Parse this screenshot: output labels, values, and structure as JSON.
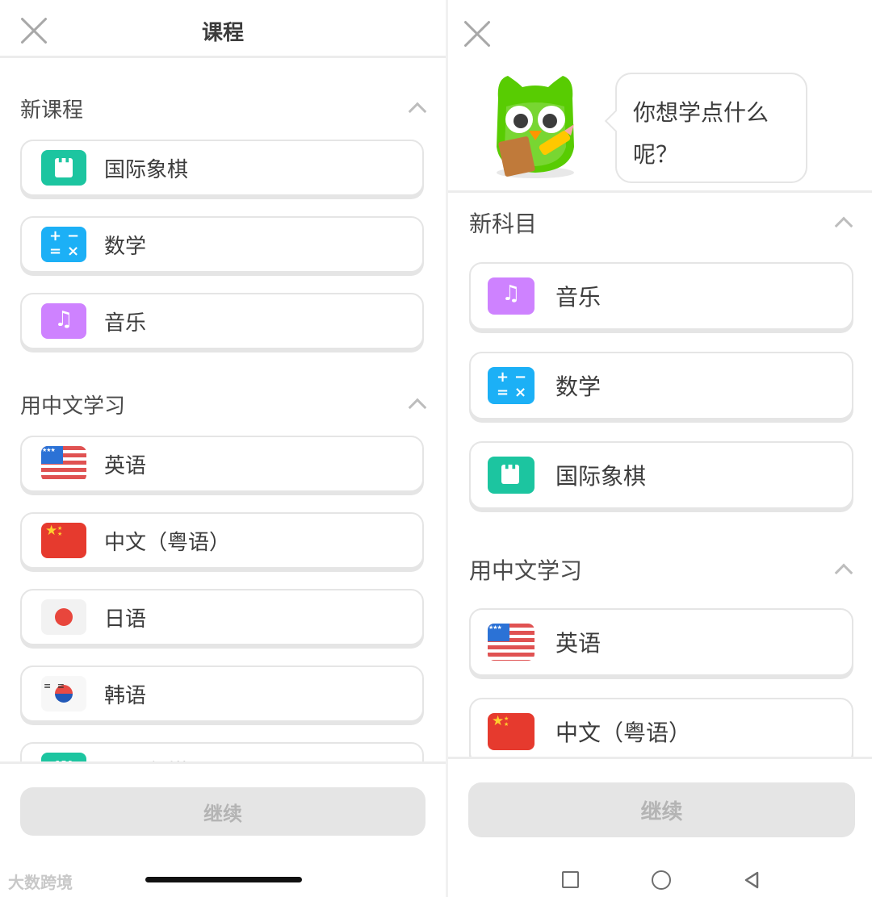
{
  "left": {
    "title": "课程",
    "sections": [
      {
        "title": "新课程",
        "items": [
          {
            "label": "国际象棋",
            "icon": "chess-icon"
          },
          {
            "label": "数学",
            "icon": "math-icon"
          },
          {
            "label": "音乐",
            "icon": "music-icon"
          }
        ]
      },
      {
        "title": "用中文学习",
        "items": [
          {
            "label": "英语",
            "icon": "us-flag-icon"
          },
          {
            "label": "中文（粤语）",
            "icon": "china-flag-icon"
          },
          {
            "label": "日语",
            "icon": "japan-flag-icon"
          },
          {
            "label": "韩语",
            "icon": "korea-flag-icon"
          },
          {
            "label": "国际象棋",
            "icon": "chess-icon"
          }
        ]
      }
    ],
    "continue_label": "继续"
  },
  "right": {
    "bubble_text": "你想学点什么呢？",
    "sections": [
      {
        "title": "新科目",
        "items": [
          {
            "label": "音乐",
            "icon": "music-icon"
          },
          {
            "label": "数学",
            "icon": "math-icon"
          },
          {
            "label": "国际象棋",
            "icon": "chess-icon"
          }
        ]
      },
      {
        "title": "用中文学习",
        "items": [
          {
            "label": "英语",
            "icon": "us-flag-icon"
          },
          {
            "label": "中文（粤语）",
            "icon": "china-flag-icon"
          }
        ]
      }
    ],
    "continue_label": "继续"
  },
  "watermark": "大数跨境",
  "colors": {
    "chess": "#1cc5a0",
    "math": "#1cb0f6",
    "music": "#ce82ff",
    "owl": "#58cc02",
    "button_disabled": "#e5e5e5"
  },
  "icons": {
    "math_symbols": [
      "+",
      "−",
      "=",
      "×"
    ],
    "music_note": "♫"
  }
}
